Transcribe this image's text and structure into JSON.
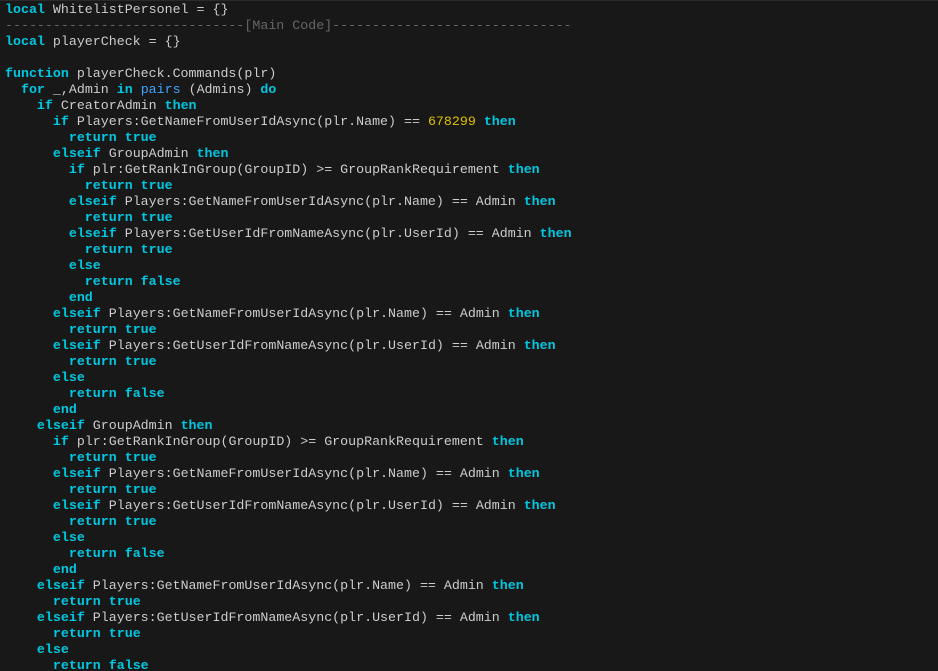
{
  "editor": {
    "colors": {
      "background": "#181818",
      "keyword": "#00c8e0",
      "builtin": "#3fa3ff",
      "number": "#e0c000",
      "comment": "#666666",
      "text": "#cccccc"
    },
    "lines": [
      [
        [
          "kw",
          "local"
        ],
        [
          "id",
          " WhitelistPersonel = {}"
        ]
      ],
      [
        [
          "cm",
          "------------------------------[Main Code]------------------------------"
        ]
      ],
      [
        [
          "kw",
          "local"
        ],
        [
          "id",
          " playerCheck = {}"
        ]
      ],
      [],
      [
        [
          "kw",
          "function"
        ],
        [
          "id",
          " playerCheck.Commands(plr)"
        ]
      ],
      [
        [
          "id",
          "  "
        ],
        [
          "kw",
          "for"
        ],
        [
          "id",
          " _,Admin "
        ],
        [
          "kw",
          "in"
        ],
        [
          "id",
          " "
        ],
        [
          "bi",
          "pairs"
        ],
        [
          "id",
          " (Admins) "
        ],
        [
          "kw",
          "do"
        ]
      ],
      [
        [
          "id",
          "    "
        ],
        [
          "kw",
          "if"
        ],
        [
          "id",
          " CreatorAdmin "
        ],
        [
          "kw",
          "then"
        ]
      ],
      [
        [
          "id",
          "      "
        ],
        [
          "kw",
          "if"
        ],
        [
          "id",
          " Players:GetNameFromUserIdAsync(plr.Name) == "
        ],
        [
          "num",
          "678299"
        ],
        [
          "id",
          " "
        ],
        [
          "kw",
          "then"
        ]
      ],
      [
        [
          "id",
          "        "
        ],
        [
          "kw",
          "return"
        ],
        [
          "id",
          " "
        ],
        [
          "kw",
          "true"
        ]
      ],
      [
        [
          "id",
          "      "
        ],
        [
          "kw",
          "elseif"
        ],
        [
          "id",
          " GroupAdmin "
        ],
        [
          "kw",
          "then"
        ]
      ],
      [
        [
          "id",
          "        "
        ],
        [
          "kw",
          "if"
        ],
        [
          "id",
          " plr:GetRankInGroup(GroupID) >= GroupRankRequirement "
        ],
        [
          "kw",
          "then"
        ]
      ],
      [
        [
          "id",
          "          "
        ],
        [
          "kw",
          "return"
        ],
        [
          "id",
          " "
        ],
        [
          "kw",
          "true"
        ]
      ],
      [
        [
          "id",
          "        "
        ],
        [
          "kw",
          "elseif"
        ],
        [
          "id",
          " Players:GetNameFromUserIdAsync(plr.Name) == Admin "
        ],
        [
          "kw",
          "then"
        ]
      ],
      [
        [
          "id",
          "          "
        ],
        [
          "kw",
          "return"
        ],
        [
          "id",
          " "
        ],
        [
          "kw",
          "true"
        ]
      ],
      [
        [
          "id",
          "        "
        ],
        [
          "kw",
          "elseif"
        ],
        [
          "id",
          " Players:GetUserIdFromNameAsync(plr.UserId) == Admin "
        ],
        [
          "kw",
          "then"
        ]
      ],
      [
        [
          "id",
          "          "
        ],
        [
          "kw",
          "return"
        ],
        [
          "id",
          " "
        ],
        [
          "kw",
          "true"
        ]
      ],
      [
        [
          "id",
          "        "
        ],
        [
          "kw",
          "else"
        ]
      ],
      [
        [
          "id",
          "          "
        ],
        [
          "kw",
          "return"
        ],
        [
          "id",
          " "
        ],
        [
          "kw",
          "false"
        ]
      ],
      [
        [
          "id",
          "        "
        ],
        [
          "kw",
          "end"
        ]
      ],
      [
        [
          "id",
          "      "
        ],
        [
          "kw",
          "elseif"
        ],
        [
          "id",
          " Players:GetNameFromUserIdAsync(plr.Name) == Admin "
        ],
        [
          "kw",
          "then"
        ]
      ],
      [
        [
          "id",
          "        "
        ],
        [
          "kw",
          "return"
        ],
        [
          "id",
          " "
        ],
        [
          "kw",
          "true"
        ]
      ],
      [
        [
          "id",
          "      "
        ],
        [
          "kw",
          "elseif"
        ],
        [
          "id",
          " Players:GetUserIdFromNameAsync(plr.UserId) == Admin "
        ],
        [
          "kw",
          "then"
        ]
      ],
      [
        [
          "id",
          "        "
        ],
        [
          "kw",
          "return"
        ],
        [
          "id",
          " "
        ],
        [
          "kw",
          "true"
        ]
      ],
      [
        [
          "id",
          "      "
        ],
        [
          "kw",
          "else"
        ]
      ],
      [
        [
          "id",
          "        "
        ],
        [
          "kw",
          "return"
        ],
        [
          "id",
          " "
        ],
        [
          "kw",
          "false"
        ]
      ],
      [
        [
          "id",
          "      "
        ],
        [
          "kw",
          "end"
        ]
      ],
      [
        [
          "id",
          "    "
        ],
        [
          "kw",
          "elseif"
        ],
        [
          "id",
          " GroupAdmin "
        ],
        [
          "kw",
          "then"
        ]
      ],
      [
        [
          "id",
          "      "
        ],
        [
          "kw",
          "if"
        ],
        [
          "id",
          " plr:GetRankInGroup(GroupID) >= GroupRankRequirement "
        ],
        [
          "kw",
          "then"
        ]
      ],
      [
        [
          "id",
          "        "
        ],
        [
          "kw",
          "return"
        ],
        [
          "id",
          " "
        ],
        [
          "kw",
          "true"
        ]
      ],
      [
        [
          "id",
          "      "
        ],
        [
          "kw",
          "elseif"
        ],
        [
          "id",
          " Players:GetNameFromUserIdAsync(plr.Name) == Admin "
        ],
        [
          "kw",
          "then"
        ]
      ],
      [
        [
          "id",
          "        "
        ],
        [
          "kw",
          "return"
        ],
        [
          "id",
          " "
        ],
        [
          "kw",
          "true"
        ]
      ],
      [
        [
          "id",
          "      "
        ],
        [
          "kw",
          "elseif"
        ],
        [
          "id",
          " Players:GetUserIdFromNameAsync(plr.UserId) == Admin "
        ],
        [
          "kw",
          "then"
        ]
      ],
      [
        [
          "id",
          "        "
        ],
        [
          "kw",
          "return"
        ],
        [
          "id",
          " "
        ],
        [
          "kw",
          "true"
        ]
      ],
      [
        [
          "id",
          "      "
        ],
        [
          "kw",
          "else"
        ]
      ],
      [
        [
          "id",
          "        "
        ],
        [
          "kw",
          "return"
        ],
        [
          "id",
          " "
        ],
        [
          "kw",
          "false"
        ]
      ],
      [
        [
          "id",
          "      "
        ],
        [
          "kw",
          "end"
        ]
      ],
      [
        [
          "id",
          "    "
        ],
        [
          "kw",
          "elseif"
        ],
        [
          "id",
          " Players:GetNameFromUserIdAsync(plr.Name) == Admin "
        ],
        [
          "kw",
          "then"
        ]
      ],
      [
        [
          "id",
          "      "
        ],
        [
          "kw",
          "return"
        ],
        [
          "id",
          " "
        ],
        [
          "kw",
          "true"
        ]
      ],
      [
        [
          "id",
          "    "
        ],
        [
          "kw",
          "elseif"
        ],
        [
          "id",
          " Players:GetUserIdFromNameAsync(plr.UserId) == Admin "
        ],
        [
          "kw",
          "then"
        ]
      ],
      [
        [
          "id",
          "      "
        ],
        [
          "kw",
          "return"
        ],
        [
          "id",
          " "
        ],
        [
          "kw",
          "true"
        ]
      ],
      [
        [
          "id",
          "    "
        ],
        [
          "kw",
          "else"
        ]
      ],
      [
        [
          "id",
          "      "
        ],
        [
          "kw",
          "return"
        ],
        [
          "id",
          " "
        ],
        [
          "kw",
          "false"
        ]
      ]
    ]
  }
}
